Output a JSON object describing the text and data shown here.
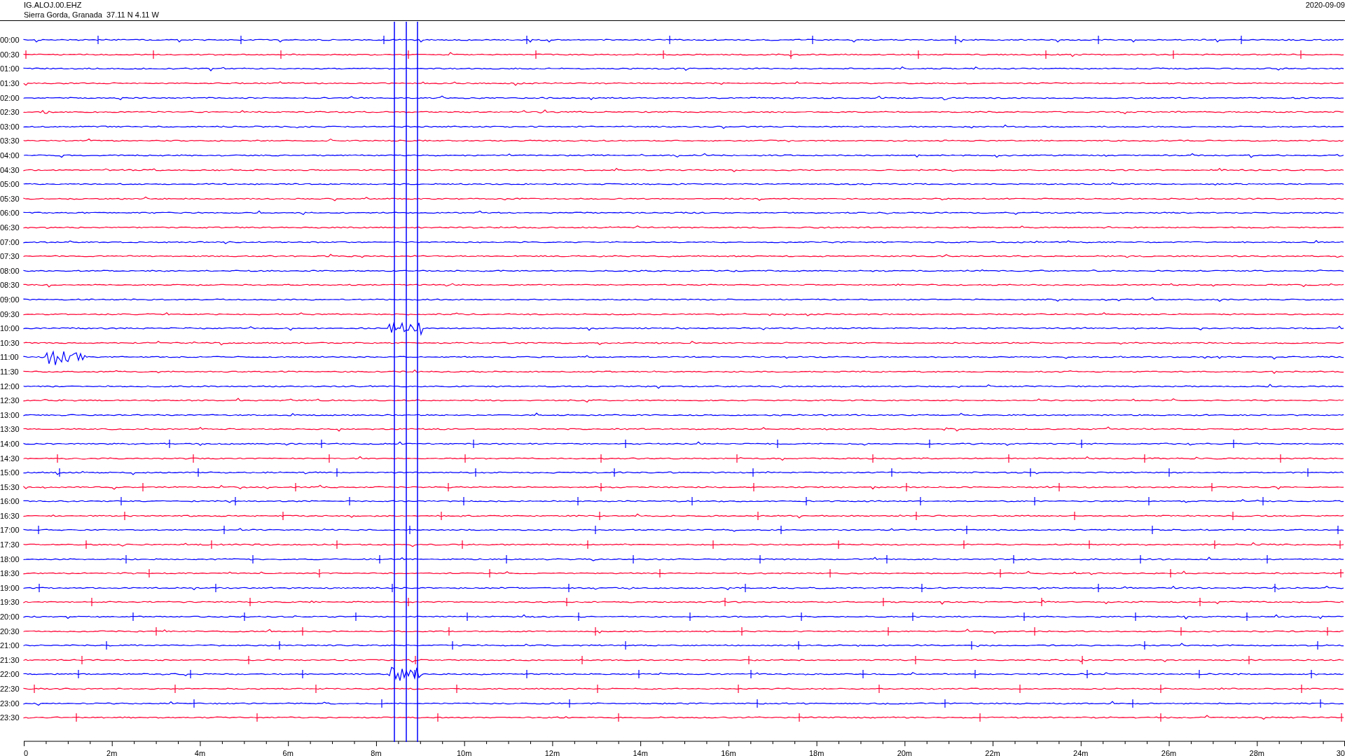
{
  "header": {
    "station": "IG.ALOJ.00.EHZ",
    "location": "Sierra Gorda, Granada  37.11 N 4.11 W",
    "date": "2020-09-09"
  },
  "rows": [
    {
      "time": "00:00",
      "color": "#0000ff"
    },
    {
      "time": "00:30",
      "color": "#ff0033"
    },
    {
      "time": "01:00",
      "color": "#0000ff"
    },
    {
      "time": "01:30",
      "color": "#ff0033"
    },
    {
      "time": "02:00",
      "color": "#0000ff"
    },
    {
      "time": "02:30",
      "color": "#ff0033"
    },
    {
      "time": "03:00",
      "color": "#0000ff"
    },
    {
      "time": "03:30",
      "color": "#ff0033"
    },
    {
      "time": "04:00",
      "color": "#0000ff"
    },
    {
      "time": "04:30",
      "color": "#ff0033"
    },
    {
      "time": "05:00",
      "color": "#0000ff"
    },
    {
      "time": "05:30",
      "color": "#ff0033"
    },
    {
      "time": "06:00",
      "color": "#0000ff"
    },
    {
      "time": "06:30",
      "color": "#ff0033"
    },
    {
      "time": "07:00",
      "color": "#0000ff"
    },
    {
      "time": "07:30",
      "color": "#ff0033"
    },
    {
      "time": "08:00",
      "color": "#0000ff"
    },
    {
      "time": "08:30",
      "color": "#ff0033"
    },
    {
      "time": "09:00",
      "color": "#0000ff"
    },
    {
      "time": "09:30",
      "color": "#ff0033"
    },
    {
      "time": "10:00",
      "color": "#0000ff"
    },
    {
      "time": "10:30",
      "color": "#ff0033"
    },
    {
      "time": "11:00",
      "color": "#0000ff"
    },
    {
      "time": "11:30",
      "color": "#ff0033"
    },
    {
      "time": "12:00",
      "color": "#0000ff"
    },
    {
      "time": "12:30",
      "color": "#ff0033"
    },
    {
      "time": "13:00",
      "color": "#0000ff"
    },
    {
      "time": "13:30",
      "color": "#ff0033"
    },
    {
      "time": "14:00",
      "color": "#0000ff"
    },
    {
      "time": "14:30",
      "color": "#ff0033"
    },
    {
      "time": "15:00",
      "color": "#0000ff"
    },
    {
      "time": "15:30",
      "color": "#ff0033"
    },
    {
      "time": "16:00",
      "color": "#0000ff"
    },
    {
      "time": "16:30",
      "color": "#ff0033"
    },
    {
      "time": "17:00",
      "color": "#0000ff"
    },
    {
      "time": "17:30",
      "color": "#ff0033"
    },
    {
      "time": "18:00",
      "color": "#0000ff"
    },
    {
      "time": "18:30",
      "color": "#ff0033"
    },
    {
      "time": "19:00",
      "color": "#0000ff"
    },
    {
      "time": "19:30",
      "color": "#ff0033"
    },
    {
      "time": "20:00",
      "color": "#0000ff"
    },
    {
      "time": "20:30",
      "color": "#ff0033"
    },
    {
      "time": "21:00",
      "color": "#0000ff"
    },
    {
      "time": "21:30",
      "color": "#ff0033"
    },
    {
      "time": "22:00",
      "color": "#0000ff"
    },
    {
      "time": "22:30",
      "color": "#ff0033"
    },
    {
      "time": "23:00",
      "color": "#0000ff"
    },
    {
      "time": "23:30",
      "color": "#ff0033"
    }
  ],
  "x_axis": {
    "labels": [
      "0",
      "2m",
      "4m",
      "6m",
      "8m",
      "10m",
      "12m",
      "14m",
      "16m",
      "18m",
      "20m",
      "22m",
      "24m",
      "26m",
      "28m",
      "30"
    ]
  }
}
